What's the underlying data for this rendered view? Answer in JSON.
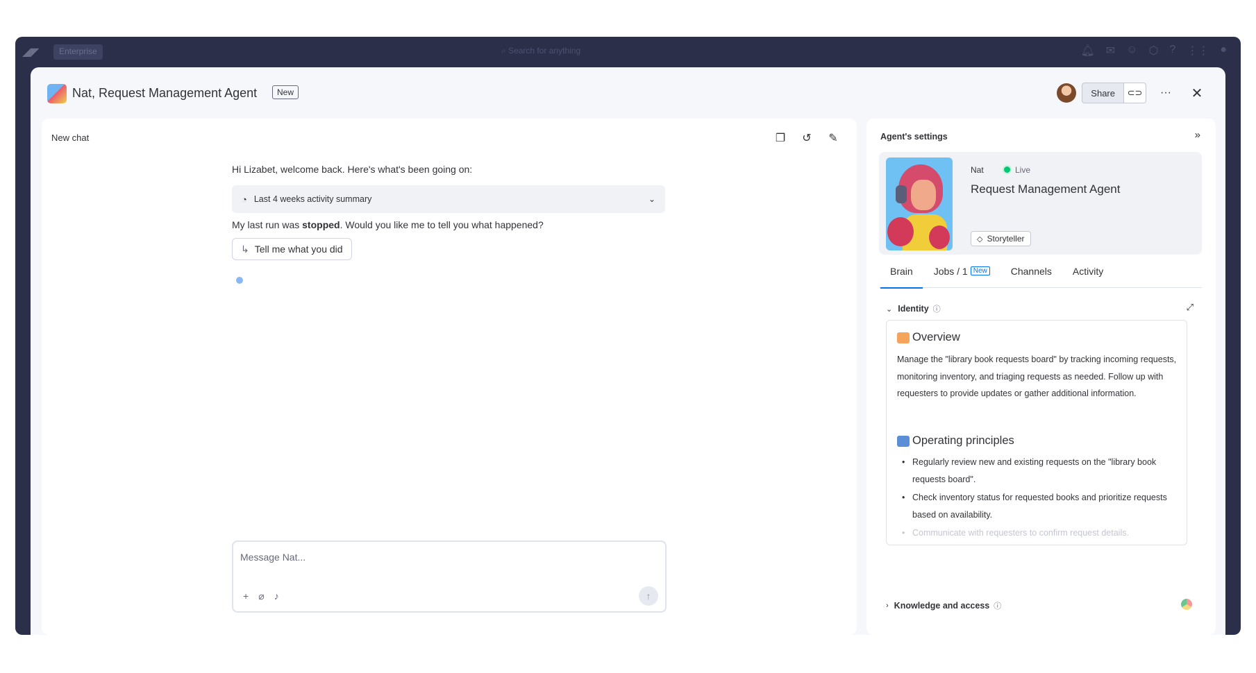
{
  "topbar": {
    "workspace": "Enterprise",
    "search_placeholder": "Search for anything"
  },
  "header": {
    "title": "Nat, Request Management Agent",
    "badge": "New",
    "share_label": "Share"
  },
  "chat": {
    "label": "New chat",
    "greeting": "Hi Lizabet, welcome back. Here's what's been going on:",
    "summary_label": "Last 4 weeks activity summary",
    "lastrun_prefix": "My last run was ",
    "lastrun_bold": "stopped",
    "lastrun_suffix": ". Would you like me to tell you what happened?",
    "suggestion": "Tell me what you did",
    "composer_placeholder": "Message Nat..."
  },
  "settings": {
    "title": "Agent's settings",
    "agent_name": "Nat",
    "status": "Live",
    "role": "Request Management Agent",
    "persona": "Storyteller",
    "tabs": [
      {
        "label": "Brain"
      },
      {
        "label": "Jobs / 1",
        "badge": "New"
      },
      {
        "label": "Channels"
      },
      {
        "label": "Activity"
      }
    ],
    "identity_label": "Identity",
    "overview_title": "Overview",
    "overview_text": "Manage the \"library book requests board\" by tracking incoming requests, monitoring inventory, and triaging requests as needed. Follow up with requesters to provide updates or gather additional information.",
    "principles_title": "Operating principles",
    "principles": [
      "Regularly review new and existing requests on the \"library book requests board\".",
      "Check inventory status for requested books and prioritize requests based on availability.",
      "Communicate with requesters to confirm request details."
    ],
    "knowledge_label": "Knowledge and access"
  },
  "colors": {
    "accent": "#0073ea",
    "live": "#00c875",
    "frame": "#2b2f4a"
  }
}
